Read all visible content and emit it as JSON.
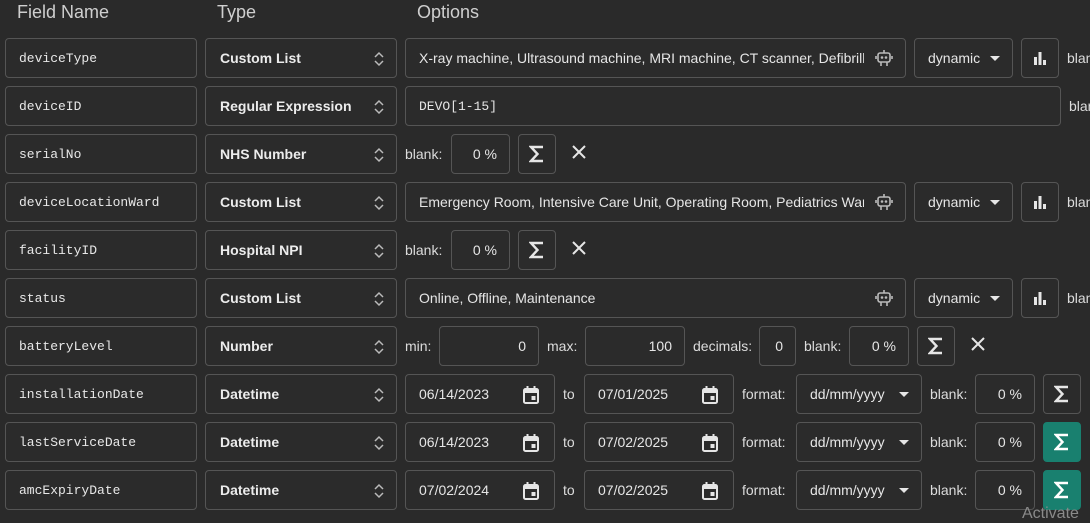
{
  "headers": {
    "field_name": "Field Name",
    "type": "Type",
    "options": "Options"
  },
  "labels": {
    "blank": "blank:",
    "blank_cut": "blan",
    "min": "min:",
    "max": "max:",
    "decimals": "decimals:",
    "to": "to",
    "format": "format:"
  },
  "rows": [
    {
      "name": "deviceType",
      "type": "Custom List",
      "options": "X-ray machine, Ultrasound machine, MRI machine, CT scanner, Defibrillator",
      "mode": "dynamic"
    },
    {
      "name": "deviceID",
      "type": "Regular Expression",
      "options": "DEVO[1-15]"
    },
    {
      "name": "serialNo",
      "type": "NHS Number",
      "blank": "0 %"
    },
    {
      "name": "deviceLocationWard",
      "type": "Custom List",
      "options": "Emergency Room, Intensive Care Unit, Operating Room, Pediatrics Ward",
      "mode": "dynamic"
    },
    {
      "name": "facilityID",
      "type": "Hospital NPI",
      "blank": "0 %"
    },
    {
      "name": "status",
      "type": "Custom List",
      "options": "Online, Offline, Maintenance",
      "mode": "dynamic"
    },
    {
      "name": "batteryLevel",
      "type": "Number",
      "min": "0",
      "max": "100",
      "decimals": "0",
      "blank": "0 %"
    },
    {
      "name": "installationDate",
      "type": "Datetime",
      "from": "06/14/2023",
      "to": "07/01/2025",
      "format": "dd/mm/yyyy",
      "blank": "0 %"
    },
    {
      "name": "lastServiceDate",
      "type": "Datetime",
      "from": "06/14/2023",
      "to": "07/02/2025",
      "format": "dd/mm/yyyy",
      "blank": "0 %"
    },
    {
      "name": "amcExpiryDate",
      "type": "Datetime",
      "from": "07/02/2024",
      "to": "07/02/2025",
      "format": "dd/mm/yyyy",
      "blank": "0 %"
    }
  ],
  "watermark": "Activate",
  "colors": {
    "accent": "#19806f",
    "background": "#2a2a2a",
    "border": "#555555"
  }
}
